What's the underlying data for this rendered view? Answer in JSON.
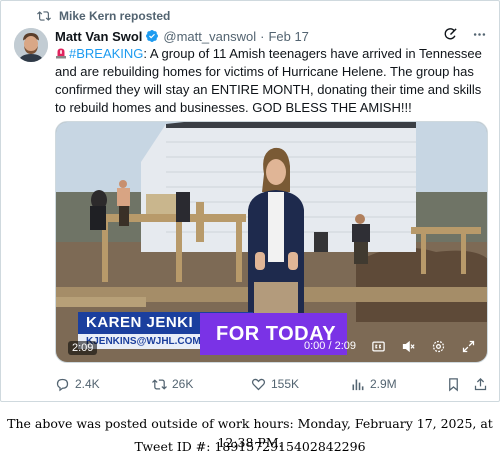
{
  "repost": {
    "icon": "repost-icon",
    "label": "Mike Kern reposted"
  },
  "author": {
    "name": "Matt Van Swol",
    "handle": "@matt_vanswol",
    "separator": "·",
    "date": "Feb 17"
  },
  "tweet": {
    "siren_icon": "siren-icon",
    "hashtag": "#BREAKING",
    "text": ": A group of 11 Amish teenagers have arrived in Tennessee and are rebuilding homes for victims of Hurricane Helene. The group has confirmed they will stay an ENTIRE MONTH, donating their time and skills to rebuild homes and businesses. GOD BLESS THE AMISH!!!"
  },
  "video": {
    "lower_third_name": "KAREN JENKI",
    "lower_third_email": "KJENKINS@WJHL.COM",
    "banner": "FOR TODAY",
    "elapsed": "2:09",
    "progress_time": "0:00 / 2:09"
  },
  "actions": {
    "replies": "2.4K",
    "reposts": "26K",
    "likes": "155K",
    "views": "2.9M"
  },
  "footer": {
    "line1": "The above was posted outside of work hours: Monday, February 17, 2025, at 12:38 PM.",
    "line2": "Tweet ID #: 1891572915402842296"
  },
  "colors": {
    "link": "#1d9bf0",
    "verified": "#1d9bf0",
    "muted": "#536471",
    "banner_purple": "#7a33e6",
    "lower_third_blue": "#1b3f9e"
  }
}
